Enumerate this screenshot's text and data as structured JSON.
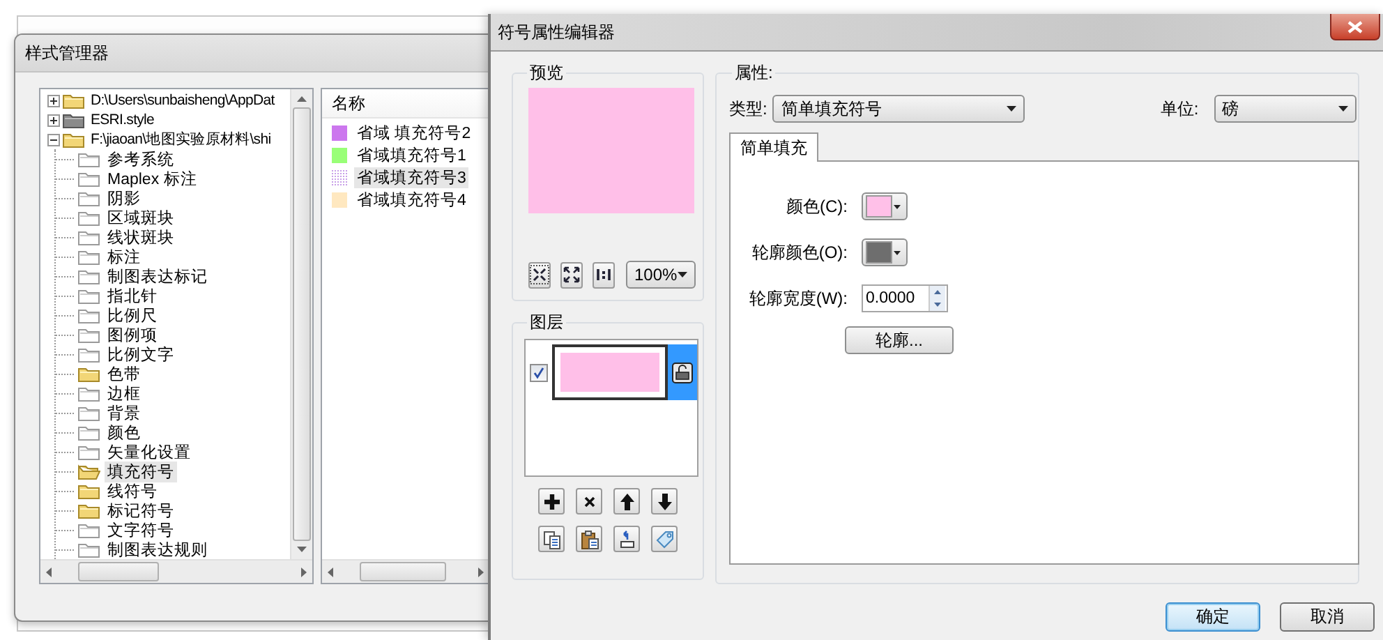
{
  "style_manager": {
    "title": "样式管理器",
    "tree": [
      {
        "label": "D:\\Users\\sunbaisheng\\AppDat",
        "kind": "folder",
        "expanded": false
      },
      {
        "label": "ESRI.style",
        "kind": "style",
        "expanded": false
      },
      {
        "label": "F:\\jiaoan\\地图实验原材料\\shi",
        "kind": "folder",
        "expanded": true,
        "children": [
          {
            "label": "参考系统",
            "kind": "empty",
            "selected": false
          },
          {
            "label": "Maplex 标注",
            "kind": "empty",
            "selected": false
          },
          {
            "label": "阴影",
            "kind": "empty",
            "selected": false
          },
          {
            "label": "区域斑块",
            "kind": "empty",
            "selected": false
          },
          {
            "label": "线状斑块",
            "kind": "empty",
            "selected": false
          },
          {
            "label": "标注",
            "kind": "empty",
            "selected": false
          },
          {
            "label": "制图表达标记",
            "kind": "empty",
            "selected": false
          },
          {
            "label": "指北针",
            "kind": "empty",
            "selected": false
          },
          {
            "label": "比例尺",
            "kind": "empty",
            "selected": false
          },
          {
            "label": "图例项",
            "kind": "empty",
            "selected": false
          },
          {
            "label": "比例文字",
            "kind": "empty",
            "selected": false
          },
          {
            "label": "色带",
            "kind": "filled",
            "selected": false
          },
          {
            "label": "边框",
            "kind": "empty",
            "selected": false
          },
          {
            "label": "背景",
            "kind": "empty",
            "selected": false
          },
          {
            "label": "颜色",
            "kind": "empty",
            "selected": false
          },
          {
            "label": "矢量化设置",
            "kind": "empty",
            "selected": false
          },
          {
            "label": "填充符号",
            "kind": "filled",
            "selected": true
          },
          {
            "label": "线符号",
            "kind": "filled",
            "selected": false
          },
          {
            "label": "标记符号",
            "kind": "filled",
            "selected": false
          },
          {
            "label": "文字符号",
            "kind": "empty",
            "selected": false
          },
          {
            "label": "制图表达规则",
            "kind": "empty",
            "selected": false
          }
        ]
      }
    ],
    "list": {
      "columns": [
        "名称"
      ],
      "items": [
        {
          "label": "省域 填充符号2",
          "kind": "solid",
          "color": "#cc77ee",
          "selected": false
        },
        {
          "label": "省域填充符号1",
          "kind": "solid",
          "color": "#99ff77",
          "selected": false
        },
        {
          "label": "省域填充符号3",
          "kind": "dotted",
          "color": "#c8a0e8",
          "selected": true
        },
        {
          "label": "省域填充符号4",
          "kind": "solid",
          "color": "#ffe8c0",
          "selected": false
        }
      ]
    }
  },
  "symbol_editor": {
    "title": "符号属性编辑器",
    "preview": {
      "label": "预览",
      "color": "#ffbfe8",
      "zoom": "100%"
    },
    "layers": {
      "label": "图层",
      "items": [
        {
          "checked": true,
          "selected": true,
          "color": "#ffbfe8"
        }
      ]
    },
    "properties": {
      "label": "属性:",
      "type_label": "类型:",
      "type_value": "简单填充符号",
      "unit_label": "单位:",
      "unit_value": "磅",
      "tabs": [
        {
          "label": "简单填充",
          "selected": true
        }
      ],
      "fields": [
        {
          "kind": "color",
          "label": "颜色(C):",
          "color": "#ffc0e8"
        },
        {
          "kind": "color",
          "label": "轮廓颜色(O):",
          "color": "#6e6e6e"
        },
        {
          "kind": "number",
          "label": "轮廓宽度(W):",
          "value": "0.0000"
        },
        {
          "kind": "button",
          "label": "轮廓..."
        }
      ]
    },
    "buttons": [
      {
        "label": "确定",
        "default": true
      },
      {
        "label": "取消",
        "default": false
      }
    ]
  }
}
